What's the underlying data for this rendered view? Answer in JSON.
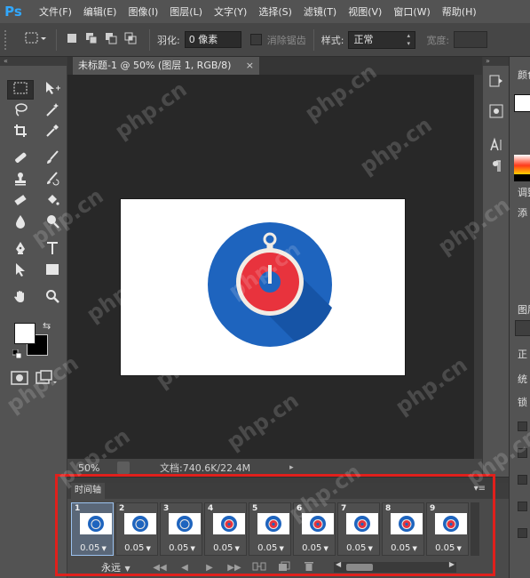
{
  "app": {
    "logo": "Ps"
  },
  "menu": [
    "文件(F)",
    "编辑(E)",
    "图像(I)",
    "图层(L)",
    "文字(Y)",
    "选择(S)",
    "滤镜(T)",
    "视图(V)",
    "窗口(W)",
    "帮助(H)"
  ],
  "options": {
    "feather_label": "羽化:",
    "feather_value": "0 像素",
    "antialias_label": "消除锯齿",
    "style_label": "样式:",
    "style_value": "正常",
    "width_label": "宽度:"
  },
  "document": {
    "tab_title": "未标题-1 @ 50% (图层 1, RGB/8)",
    "close_glyph": "×",
    "zoom": "50%",
    "doc_info": "文档:740.6K/22.4M",
    "status_arrow": "▸"
  },
  "right_panel": {
    "color_label": "颜色",
    "adjust_label": "调整",
    "add_label": "添",
    "layers_label": "图层",
    "normal_label": "正",
    "unify_label": "统",
    "lock_label": "锁"
  },
  "timeline": {
    "tab_label": "时间轴",
    "menu_glyph": "▾≡",
    "loop_value": "永远",
    "frames": [
      {
        "number": "1",
        "delay": "0.05",
        "variant": "blue"
      },
      {
        "number": "2",
        "delay": "0.05",
        "variant": "blue"
      },
      {
        "number": "3",
        "delay": "0.05",
        "variant": "blue"
      },
      {
        "number": "4",
        "delay": "0.05",
        "variant": "red"
      },
      {
        "number": "5",
        "delay": "0.05",
        "variant": "red"
      },
      {
        "number": "6",
        "delay": "0.05",
        "variant": "red"
      },
      {
        "number": "7",
        "delay": "0.05",
        "variant": "red"
      },
      {
        "number": "8",
        "delay": "0.05",
        "variant": "red"
      },
      {
        "number": "9",
        "delay": "0.05",
        "variant": "red"
      }
    ]
  },
  "watermark_text": "php.cn",
  "colors": {
    "highlight": "#e0201c",
    "stopwatch_blue": "#1e64be",
    "stopwatch_red": "#e8333d",
    "stopwatch_rim": "#f2ece4"
  }
}
